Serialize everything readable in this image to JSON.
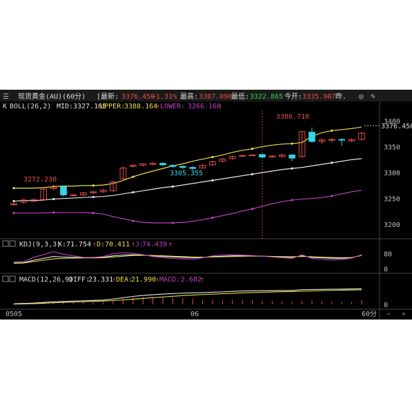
{
  "header": {
    "title": "现货黄金(AU)(60分)",
    "latest_label": "最新:",
    "latest": "3376.450",
    "change_pct": "+1.31%",
    "high_label": "最高:",
    "high": "3387.090",
    "low_label": "最低:",
    "low": "3322.865",
    "open_label": "今开:",
    "open": "3335.907",
    "tail": "昨."
  },
  "boll_legend": {
    "prefix": "K",
    "name": "BOLL(26,2)",
    "mid_label": "MID:",
    "mid": "3327.165",
    "upper_label": "UPPER:",
    "upper": "3388.164",
    "lower_label": "LOWER:",
    "lower": "3266.166",
    "arrow": "↑"
  },
  "kdj_legend": {
    "name": "KDJ(9,3,3)",
    "k_label": "K:",
    "k": "71.754",
    "d_label": "D:",
    "d": "70.411",
    "j_label": "J:",
    "j": "74.439",
    "arrow": "↑"
  },
  "macd_legend": {
    "name": "MACD(12,26,9)",
    "diff_label": "DIFF:",
    "diff": "23.331",
    "dea_label": "DEA:",
    "dea": "21.990",
    "macd_label": "MACD:",
    "macd": "2.682",
    "arrow": "↑"
  },
  "x_axis": {
    "start": "0505",
    "mid": "06",
    "period": "60分",
    "minus": "−",
    "plus": "+"
  },
  "annotations": {
    "high_marker": "3386.710",
    "low_marker": "3272.230",
    "mid_marker": "3305.355",
    "current_price": "3376.450"
  },
  "colors": {
    "bg": "#000000",
    "up": "#e84c4c",
    "down": "#33d6e8",
    "mid_line": "#e8e8e8",
    "upper_line": "#e8e04a",
    "lower_line": "#c040c8",
    "k_line": "#e8e8e8",
    "d_line": "#e8e04a",
    "j_line": "#c040c8",
    "diff_line": "#e8e8e8",
    "dea_line": "#e8e04a"
  },
  "chart_data": [
    {
      "type": "candlestick",
      "title": "现货黄金(AU)(60分)",
      "y_ticks": [
        3400,
        3350,
        3300,
        3250,
        3200
      ],
      "ylim": [
        3175,
        3420
      ],
      "candles": [
        {
          "o": 3238,
          "c": 3240,
          "h": 3242,
          "l": 3236
        },
        {
          "o": 3243,
          "c": 3247,
          "h": 3250,
          "l": 3240
        },
        {
          "o": 3245,
          "c": 3248,
          "h": 3250,
          "l": 3243
        },
        {
          "o": 3248,
          "c": 3268,
          "h": 3270,
          "l": 3246
        },
        {
          "o": 3269,
          "c": 3272,
          "h": 3274,
          "l": 3266
        },
        {
          "o": 3273,
          "c": 3257,
          "h": 3275,
          "l": 3254
        },
        {
          "o": 3256,
          "c": 3257,
          "h": 3259,
          "l": 3254
        },
        {
          "o": 3257,
          "c": 3261,
          "h": 3263,
          "l": 3255
        },
        {
          "o": 3261,
          "c": 3263,
          "h": 3265,
          "l": 3259
        },
        {
          "o": 3263,
          "c": 3266,
          "h": 3268,
          "l": 3261
        },
        {
          "o": 3265,
          "c": 3282,
          "h": 3284,
          "l": 3263
        },
        {
          "o": 3288,
          "c": 3309,
          "h": 3312,
          "l": 3285
        },
        {
          "o": 3312,
          "c": 3314,
          "h": 3316,
          "l": 3310
        },
        {
          "o": 3314,
          "c": 3317,
          "h": 3318,
          "l": 3312
        },
        {
          "o": 3316,
          "c": 3318,
          "h": 3320,
          "l": 3314
        },
        {
          "o": 3318,
          "c": 3315,
          "h": 3320,
          "l": 3313
        },
        {
          "o": 3314,
          "c": 3312,
          "h": 3316,
          "l": 3309
        },
        {
          "o": 3312,
          "c": 3310,
          "h": 3314,
          "l": 3307
        },
        {
          "o": 3310,
          "c": 3308,
          "h": 3312,
          "l": 3305
        },
        {
          "o": 3309,
          "c": 3314,
          "h": 3316,
          "l": 3308
        },
        {
          "o": 3315,
          "c": 3321,
          "h": 3323,
          "l": 3313
        },
        {
          "o": 3322,
          "c": 3326,
          "h": 3328,
          "l": 3320
        },
        {
          "o": 3327,
          "c": 3331,
          "h": 3333,
          "l": 3325
        },
        {
          "o": 3332,
          "c": 3333,
          "h": 3334,
          "l": 3330
        },
        {
          "o": 3334,
          "c": 3334,
          "h": 3335,
          "l": 3333
        },
        {
          "o": 3335,
          "c": 3330,
          "h": 3336,
          "l": 3328
        },
        {
          "o": 3330,
          "c": 3332,
          "h": 3334,
          "l": 3329
        },
        {
          "o": 3331,
          "c": 3334,
          "h": 3336,
          "l": 3329
        },
        {
          "o": 3334,
          "c": 3328,
          "h": 3336,
          "l": 3322
        },
        {
          "o": 3331,
          "c": 3379,
          "h": 3380,
          "l": 3329
        },
        {
          "o": 3378,
          "c": 3360,
          "h": 3387,
          "l": 3358
        },
        {
          "o": 3360,
          "c": 3363,
          "h": 3366,
          "l": 3356
        },
        {
          "o": 3363,
          "c": 3364,
          "h": 3366,
          "l": 3358
        },
        {
          "o": 3364,
          "c": 3363,
          "h": 3366,
          "l": 3352
        },
        {
          "o": 3361,
          "c": 3364,
          "h": 3366,
          "l": 3359
        },
        {
          "o": 3364,
          "c": 3376,
          "h": 3378,
          "l": 3362
        }
      ],
      "boll_upper": [
        3270,
        3270,
        3270,
        3271,
        3273,
        3274,
        3274,
        3275,
        3275,
        3276,
        3279,
        3285,
        3292,
        3298,
        3303,
        3308,
        3313,
        3317,
        3322,
        3326,
        3330,
        3334,
        3339,
        3343,
        3346,
        3350,
        3353,
        3355,
        3356,
        3358,
        3370,
        3377,
        3381,
        3383,
        3385,
        3388
      ],
      "boll_mid": [
        3245,
        3246,
        3246,
        3247,
        3249,
        3250,
        3251,
        3252,
        3253,
        3254,
        3256,
        3259,
        3262,
        3265,
        3268,
        3271,
        3273,
        3276,
        3279,
        3282,
        3285,
        3288,
        3291,
        3294,
        3297,
        3300,
        3303,
        3306,
        3308,
        3310,
        3313,
        3316,
        3319,
        3322,
        3325,
        3327
      ],
      "boll_lower": [
        3222,
        3222,
        3222,
        3222,
        3223,
        3223,
        3223,
        3223,
        3222,
        3220,
        3215,
        3211,
        3207,
        3204,
        3203,
        3203,
        3203,
        3204,
        3206,
        3209,
        3213,
        3217,
        3221,
        3226,
        3230,
        3235,
        3240,
        3244,
        3247,
        3249,
        3250,
        3252,
        3255,
        3259,
        3263,
        3266
      ]
    },
    {
      "type": "line",
      "title": "KDJ(9,3,3)",
      "y_ticks": [
        80,
        0
      ],
      "ylim": [
        -10,
        100
      ],
      "series": [
        {
          "name": "K",
          "values": [
            30,
            32,
            45,
            55,
            65,
            62,
            60,
            58,
            58,
            60,
            68,
            72,
            74,
            72,
            68,
            65,
            62,
            60,
            58,
            60,
            64,
            66,
            68,
            68,
            68,
            66,
            64,
            62,
            60,
            68,
            60,
            58,
            55,
            55,
            58,
            72
          ]
        },
        {
          "name": "D",
          "values": [
            28,
            30,
            38,
            45,
            52,
            55,
            56,
            57,
            57,
            58,
            62,
            66,
            70,
            71,
            70,
            68,
            66,
            64,
            62,
            61,
            62,
            63,
            65,
            66,
            67,
            66,
            65,
            64,
            63,
            65,
            63,
            61,
            59,
            58,
            59,
            70
          ]
        },
        {
          "name": "J",
          "values": [
            35,
            38,
            60,
            75,
            90,
            76,
            68,
            60,
            60,
            64,
            80,
            84,
            82,
            74,
            64,
            59,
            54,
            52,
            50,
            58,
            68,
            72,
            74,
            72,
            70,
            66,
            62,
            58,
            54,
            74,
            54,
            50,
            46,
            48,
            56,
            74
          ]
        }
      ]
    },
    {
      "type": "line",
      "title": "MACD(12,26,9)",
      "y_ticks": [
        0
      ],
      "ylim": [
        -5,
        30
      ],
      "series": [
        {
          "name": "DIFF",
          "values": [
            1,
            1.5,
            2,
            3,
            4,
            4.5,
            5,
            5.5,
            6,
            6.5,
            8,
            10,
            12,
            13.5,
            14.5,
            15.5,
            16.2,
            16.8,
            17.2,
            17.6,
            18.2,
            18.8,
            19.5,
            20,
            20.3,
            20.5,
            20.7,
            20.8,
            20.8,
            22,
            22.3,
            22.5,
            22.7,
            22.9,
            23.1,
            23.3
          ]
        },
        {
          "name": "DEA",
          "values": [
            0.5,
            0.8,
            1.2,
            1.8,
            2.5,
            3,
            3.5,
            4,
            4.6,
            5.1,
            5.8,
            6.7,
            7.8,
            9,
            10.1,
            11.2,
            12.2,
            13.2,
            14,
            14.7,
            15.4,
            16,
            16.6,
            17.2,
            17.7,
            18.2,
            18.6,
            19,
            19.3,
            19.7,
            20.2,
            20.6,
            21,
            21.3,
            21.6,
            21.99
          ]
        },
        {
          "name": "MACD",
          "values": [
            0.5,
            0.7,
            0.8,
            1.2,
            1.5,
            1.5,
            1.5,
            1.5,
            1.4,
            1.4,
            2.2,
            3.3,
            4.2,
            4.5,
            4.4,
            4.3,
            4,
            3.6,
            3.2,
            2.9,
            2.8,
            2.8,
            2.9,
            2.8,
            2.6,
            2.3,
            2.1,
            1.8,
            1.5,
            2.3,
            2.1,
            1.9,
            1.7,
            1.6,
            1.5,
            2.68
          ]
        }
      ]
    }
  ]
}
